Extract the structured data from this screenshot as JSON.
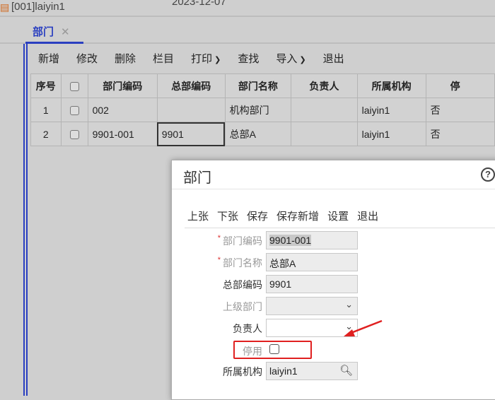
{
  "topbar": {
    "company": "[001]laiyin1",
    "date": "2023-12-07"
  },
  "tab": {
    "label": "部门",
    "close": "✕"
  },
  "toolbar": [
    "新增",
    "修改",
    "删除",
    "栏目",
    "打印",
    "查找",
    "导入",
    "退出"
  ],
  "table": {
    "headers": [
      "序号",
      "",
      "部门编码",
      "总部编码",
      "部门名称",
      "负责人",
      "所属机构",
      "停"
    ],
    "rows": [
      [
        "1",
        "",
        "002",
        "",
        "机构部门",
        "",
        "laiyin1",
        "否"
      ],
      [
        "2",
        "",
        "9901-001",
        "9901",
        "总部A",
        "",
        "laiyin1",
        "否"
      ]
    ]
  },
  "dialog": {
    "title": "部门",
    "help": "?",
    "toolbar": [
      "上张",
      "下张",
      "保存",
      "保存新增",
      "设置",
      "退出"
    ],
    "fields": {
      "code_label": "部门编码",
      "code": "9901-001",
      "name_label": "部门名称",
      "name": "总部A",
      "hq_label": "总部编码",
      "hq": "9901",
      "parent_label": "上级部门",
      "parent": "",
      "manager_label": "负责人",
      "manager": "",
      "disabled_label": "停用",
      "org_label": "所属机构",
      "org": "laiyin1"
    },
    "required_mark": "*"
  },
  "colors": {
    "accent": "#2a3fc0",
    "highlight": "#e02020"
  }
}
